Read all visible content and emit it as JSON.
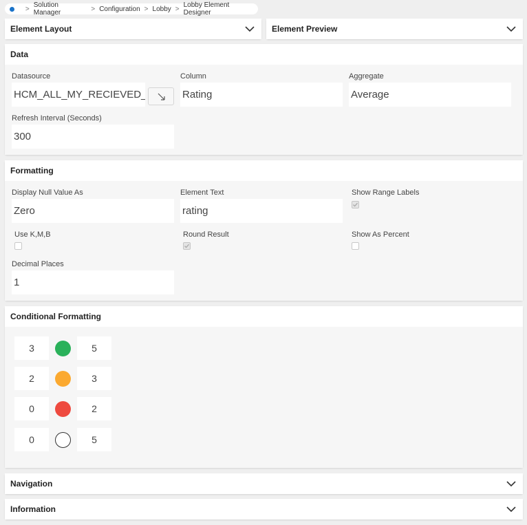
{
  "breadcrumb": {
    "items": [
      "Solution Manager",
      "Configuration",
      "Lobby",
      "Lobby Element Designer"
    ],
    "separator": ">"
  },
  "element_layout": {
    "title": "Element Layout"
  },
  "element_preview": {
    "title": "Element Preview"
  },
  "data_section": {
    "title": "Data",
    "datasource_label": "Datasource",
    "datasource_value": "HCM_ALL_MY_RECIEVED_FEEDBACK",
    "column_label": "Column",
    "column_value": "Rating",
    "aggregate_label": "Aggregate",
    "aggregate_value": "Average",
    "refresh_label": "Refresh Interval (Seconds)",
    "refresh_value": "300"
  },
  "formatting": {
    "title": "Formatting",
    "null_label": "Display Null Value As",
    "null_value": "Zero",
    "element_text_label": "Element Text",
    "element_text_value": "rating",
    "show_range_labels_label": "Show Range Labels",
    "show_range_labels_checked": true,
    "use_kmb_label": "Use K,M,B",
    "use_kmb_checked": false,
    "round_result_label": "Round Result",
    "round_result_checked": true,
    "show_percent_label": "Show As Percent",
    "show_percent_checked": false,
    "decimal_label": "Decimal Places",
    "decimal_value": "1"
  },
  "conditional_formatting": {
    "title": "Conditional Formatting",
    "rules": [
      {
        "min": "3",
        "max": "5",
        "color": "#2ab15a"
      },
      {
        "min": "2",
        "max": "3",
        "color": "#fba930"
      },
      {
        "min": "0",
        "max": "2",
        "color": "#ee4a3f"
      },
      {
        "min": "0",
        "max": "5",
        "color": "#ffffff"
      }
    ]
  },
  "navigation": {
    "title": "Navigation"
  },
  "information": {
    "title": "Information"
  },
  "colors": {
    "accent": "#1a73c9",
    "page_bg": "#efefef"
  }
}
